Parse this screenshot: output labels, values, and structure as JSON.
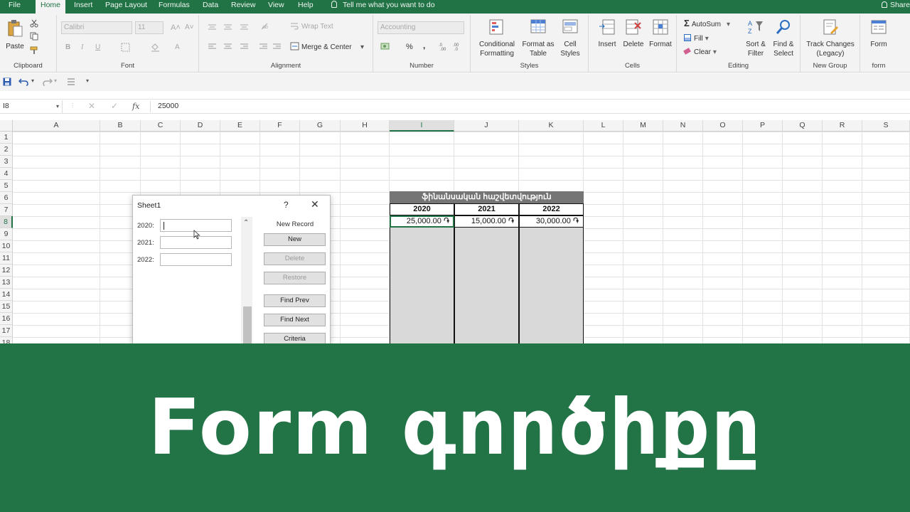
{
  "tabs": {
    "file": "File",
    "home": "Home",
    "insert": "Insert",
    "page_layout": "Page Layout",
    "formulas": "Formulas",
    "data": "Data",
    "review": "Review",
    "view": "View",
    "help": "Help",
    "tell_me": "Tell me what you want to do",
    "share": "Share"
  },
  "ribbon": {
    "clipboard": {
      "paste": "Paste",
      "label": "Clipboard"
    },
    "font": {
      "name": "Calibri",
      "size": "11",
      "label": "Font",
      "bold": "B",
      "italic": "I",
      "underline": "U",
      "font_color": "A"
    },
    "alignment": {
      "wrap_text": "Wrap Text",
      "merge_center": "Merge & Center",
      "label": "Alignment"
    },
    "number": {
      "format": "Accounting",
      "percent": "%",
      "comma": ",",
      "label": "Number"
    },
    "styles": {
      "conditional_1": "Conditional",
      "conditional_2": "Formatting",
      "format_table_1": "Format as",
      "format_table_2": "Table",
      "cell_styles_1": "Cell",
      "cell_styles_2": "Styles",
      "label": "Styles"
    },
    "cells": {
      "insert": "Insert",
      "delete": "Delete",
      "format": "Format",
      "label": "Cells"
    },
    "editing": {
      "autosum": "AutoSum",
      "fill": "Fill",
      "clear": "Clear",
      "sort_1": "Sort &",
      "sort_2": "Filter",
      "find_1": "Find &",
      "find_2": "Select",
      "label": "Editing"
    },
    "new_group": {
      "track_1": "Track Changes",
      "track_2": "(Legacy)",
      "label": "New Group"
    },
    "form_group": {
      "form": "Form",
      "label": "form"
    }
  },
  "formula_bar": {
    "name_box": "I8",
    "fx": "fx",
    "value": "25000"
  },
  "columns": [
    "A",
    "B",
    "C",
    "D",
    "E",
    "F",
    "G",
    "H",
    "I",
    "J",
    "K",
    "L",
    "M",
    "N",
    "O",
    "P",
    "Q",
    "R",
    "S"
  ],
  "rows": [
    "1",
    "2",
    "3",
    "4",
    "5",
    "6",
    "7",
    "8",
    "9",
    "10",
    "11",
    "12",
    "13",
    "14",
    "15",
    "16",
    "17",
    "18"
  ],
  "table": {
    "title": "ֆինանսական հաշվետվություն",
    "headers": [
      "2020",
      "2021",
      "2022"
    ],
    "values": [
      "25,000.00 ֏",
      "15,000.00 ֏",
      "30,000.00 ֏"
    ]
  },
  "dialog": {
    "title": "Sheet1",
    "help": "?",
    "close": "✕",
    "fields": [
      "2020:",
      "2021:",
      "2022:"
    ],
    "record_status": "New Record",
    "buttons": {
      "new": "New",
      "delete": "Delete",
      "restore": "Restore",
      "find_prev": "Find Prev",
      "find_next": "Find Next",
      "criteria": "Criteria"
    }
  },
  "banner": {
    "text": "Form գործիքը"
  },
  "colors": {
    "excel_green": "#217346",
    "banner_green": "#227447",
    "table_header": "#757575",
    "table_fill": "#d9d9d9"
  }
}
